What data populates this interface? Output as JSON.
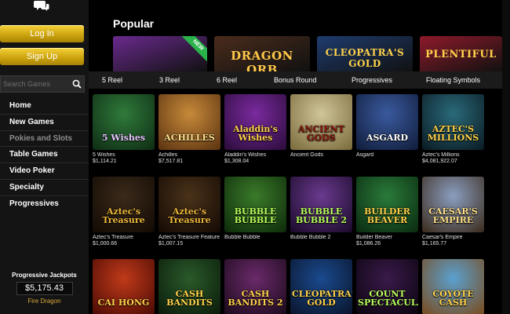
{
  "sidebar": {
    "login_label": "Log In",
    "signup_label": "Sign Up",
    "search_placeholder": "Search Games",
    "nav": [
      {
        "label": "Home"
      },
      {
        "label": "New Games"
      },
      {
        "label": "Pokies and Slots"
      },
      {
        "label": "Table Games"
      },
      {
        "label": "Video Poker"
      },
      {
        "label": "Specialty"
      },
      {
        "label": "Progressives"
      }
    ],
    "jackpot": {
      "title": "Progressive Jackpots",
      "amount": "$5,175.43",
      "game": "Fire Dragon"
    }
  },
  "main": {
    "popular_title": "Popular",
    "popular_tiles": [
      {
        "logo": "",
        "badge": "NEW",
        "color": "#6a2a8e"
      },
      {
        "logo": "DRAGON ORB",
        "color": "#4a2c1c"
      },
      {
        "logo": "CLEOPATRA'S GOLD",
        "color": "#1e3c6e"
      },
      {
        "logo": "PLENTIFUL",
        "color": "#8e1a2a"
      }
    ],
    "filters": [
      "5 Reel",
      "3 Reel",
      "6 Reel",
      "Bonus Round",
      "Progressives",
      "Floating Symbols"
    ],
    "games": [
      {
        "name": "5 Wishes",
        "jackpot": "$1,114.21",
        "logo": "5 Wishes",
        "c1": "#2f7a3a",
        "c2": "#0e2c14",
        "logo_color": "#e6c8ff"
      },
      {
        "name": "Achilles",
        "jackpot": "$7,517.81",
        "logo": "ACHILLES",
        "c1": "#c78a3a",
        "c2": "#5a3210",
        "logo_color": "#ffe08a"
      },
      {
        "name": "Aladdin's Wishes",
        "jackpot": "$1,308.04",
        "logo": "Aladdin's Wishes",
        "c1": "#7a2a9e",
        "c2": "#2a0c3a",
        "logo_color": "#ffd24a"
      },
      {
        "name": "Ancient Gods",
        "jackpot": "",
        "logo": "ANCIENT GODS",
        "c1": "#cfc59a",
        "c2": "#7a6a3a",
        "logo_color": "#8a1a0a"
      },
      {
        "name": "Asgard",
        "jackpot": "",
        "logo": "ASGARD",
        "c1": "#3a5a9e",
        "c2": "#101c3a",
        "logo_color": "#ffffff"
      },
      {
        "name": "Aztec's Millions",
        "jackpot": "$4,081,922.07",
        "logo": "AZTEC'S MILLIONS",
        "c1": "#2a6a7a",
        "c2": "#0a1a22",
        "logo_color": "#ffd24a"
      },
      {
        "name": "Aztec's Treasure",
        "jackpot": "$1,000.66",
        "logo": "Aztec's Treasure",
        "c1": "#3a2a1a",
        "c2": "#120a04",
        "logo_color": "#f0b83a"
      },
      {
        "name": "Aztec's Treasure Feature G...",
        "jackpot": "$1,007.15",
        "logo": "Aztec's Treasure",
        "c1": "#4a321a",
        "c2": "#140a04",
        "logo_color": "#f0b83a"
      },
      {
        "name": "Bubble Bubble",
        "jackpot": "",
        "logo": "BUBBLE BUBBLE",
        "c1": "#3a7a2a",
        "c2": "#0e2a0a",
        "logo_color": "#b8ff5a"
      },
      {
        "name": "Bubble Bubble 2",
        "jackpot": "",
        "logo": "BUBBLE BUBBLE 2",
        "c1": "#6a3a8e",
        "c2": "#1a0a2a",
        "logo_color": "#b8ff5a"
      },
      {
        "name": "Builder Beaver",
        "jackpot": "$1,086.26",
        "logo": "BUILDER BEAVER",
        "c1": "#2a7a3a",
        "c2": "#0a2a10",
        "logo_color": "#ffd24a"
      },
      {
        "name": "Caesar's Empire",
        "jackpot": "$1,165.77",
        "logo": "CAESAR'S EMPIRE",
        "c1": "#8a9ec0",
        "c2": "#3a2a1a",
        "logo_color": "#ffe08a"
      },
      {
        "name": "",
        "jackpot": "",
        "logo": "CAI HONG",
        "c1": "#c03a1a",
        "c2": "#4a0a04",
        "logo_color": "#ffd24a"
      },
      {
        "name": "",
        "jackpot": "",
        "logo": "CASH BANDITS",
        "c1": "#2a5a2a",
        "c2": "#0a1a0a",
        "logo_color": "#ffd24a"
      },
      {
        "name": "",
        "jackpot": "",
        "logo": "CASH BANDITS 2",
        "c1": "#6a2a6a",
        "c2": "#1a0a1a",
        "logo_color": "#ffd24a"
      },
      {
        "name": "",
        "jackpot": "",
        "logo": "CLEOPATRA'S GOLD",
        "c1": "#1a4a8e",
        "c2": "#0a142a",
        "logo_color": "#ffd24a"
      },
      {
        "name": "",
        "jackpot": "",
        "logo": "COUNT SPECTACULAR",
        "c1": "#3a1a4a",
        "c2": "#0a040e",
        "logo_color": "#b8ff5a"
      },
      {
        "name": "",
        "jackpot": "",
        "logo": "COYOTE CASH",
        "c1": "#5aa0d0",
        "c2": "#7a4a1a",
        "logo_color": "#ffd24a"
      }
    ]
  }
}
